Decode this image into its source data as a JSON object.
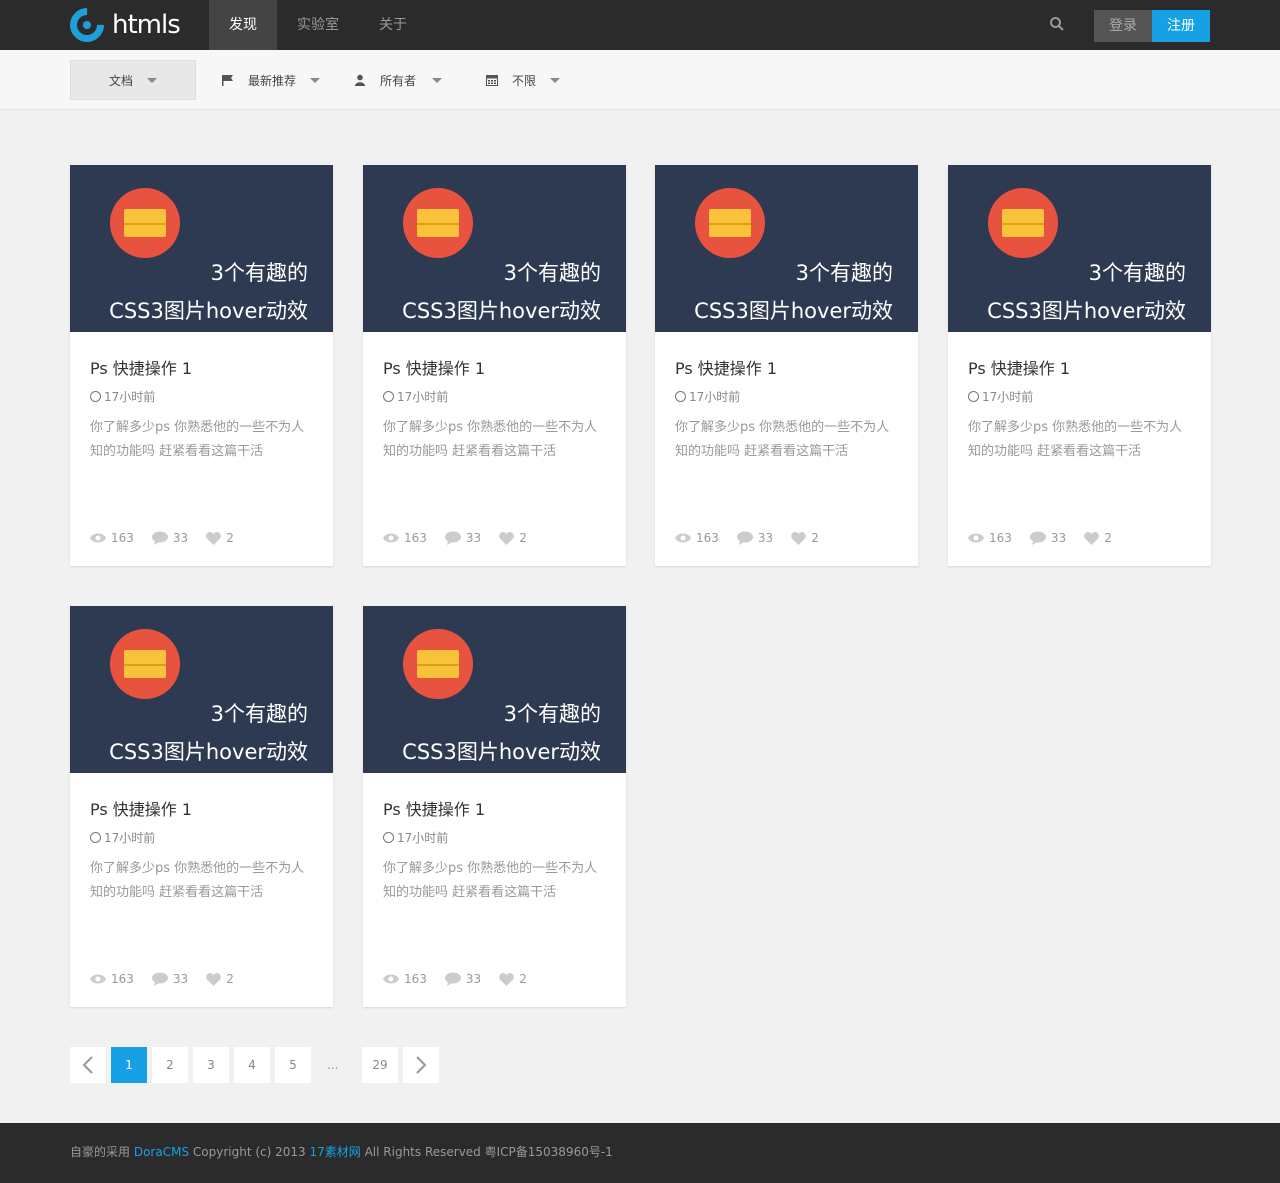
{
  "header": {
    "logo_text": "htmls",
    "nav": [
      {
        "label": "发现",
        "active": true
      },
      {
        "label": "实验室",
        "active": false
      },
      {
        "label": "关于",
        "active": false
      }
    ],
    "login_label": "登录",
    "register_label": "注册"
  },
  "filters": [
    {
      "label": "文档",
      "icon": "none"
    },
    {
      "label": "最新推荐",
      "icon": "flag-icon"
    },
    {
      "label": "所有者",
      "icon": "user-icon"
    },
    {
      "label": "不限",
      "icon": "calendar-icon"
    }
  ],
  "cards": [
    {
      "thumb_line1": "3个有趣的",
      "thumb_line2": "CSS3图片hover动效",
      "title": "Ps 快捷操作 1",
      "time": "17小时前",
      "desc": "你了解多少ps 你熟悉他的一些不为人知的功能吗 赶紧看看这篇干活",
      "views": "163",
      "comments": "33",
      "likes": "2"
    },
    {
      "thumb_line1": "3个有趣的",
      "thumb_line2": "CSS3图片hover动效",
      "title": "Ps 快捷操作 1",
      "time": "17小时前",
      "desc": "你了解多少ps 你熟悉他的一些不为人知的功能吗 赶紧看看这篇干活",
      "views": "163",
      "comments": "33",
      "likes": "2"
    },
    {
      "thumb_line1": "3个有趣的",
      "thumb_line2": "CSS3图片hover动效",
      "title": "Ps 快捷操作 1",
      "time": "17小时前",
      "desc": "你了解多少ps 你熟悉他的一些不为人知的功能吗 赶紧看看这篇干活",
      "views": "163",
      "comments": "33",
      "likes": "2"
    },
    {
      "thumb_line1": "3个有趣的",
      "thumb_line2": "CSS3图片hover动效",
      "title": "Ps 快捷操作 1",
      "time": "17小时前",
      "desc": "你了解多少ps 你熟悉他的一些不为人知的功能吗 赶紧看看这篇干活",
      "views": "163",
      "comments": "33",
      "likes": "2"
    },
    {
      "thumb_line1": "3个有趣的",
      "thumb_line2": "CSS3图片hover动效",
      "title": "Ps 快捷操作 1",
      "time": "17小时前",
      "desc": "你了解多少ps 你熟悉他的一些不为人知的功能吗 赶紧看看这篇干活",
      "views": "163",
      "comments": "33",
      "likes": "2"
    },
    {
      "thumb_line1": "3个有趣的",
      "thumb_line2": "CSS3图片hover动效",
      "title": "Ps 快捷操作 1",
      "time": "17小时前",
      "desc": "你了解多少ps 你熟悉他的一些不为人知的功能吗 赶紧看看这篇干活",
      "views": "163",
      "comments": "33",
      "likes": "2"
    }
  ],
  "pagination": {
    "pages": [
      "1",
      "2",
      "3",
      "4",
      "5"
    ],
    "current": "1",
    "ellipsis": "...",
    "last": "29"
  },
  "footer": {
    "prefix": "自豪的采用",
    "cms_link": "DoraCMS",
    "copyright": "Copyright (c) 2013",
    "site_link": "17素材网",
    "suffix": "All Rights Reserved 粤ICP备15038960号-1"
  },
  "colors": {
    "accent": "#16a1e7",
    "topbar": "#2b2b2b",
    "thumb_bg": "#2e3a52",
    "mail_circle": "#e8533f",
    "envelope": "#f8c23a"
  }
}
